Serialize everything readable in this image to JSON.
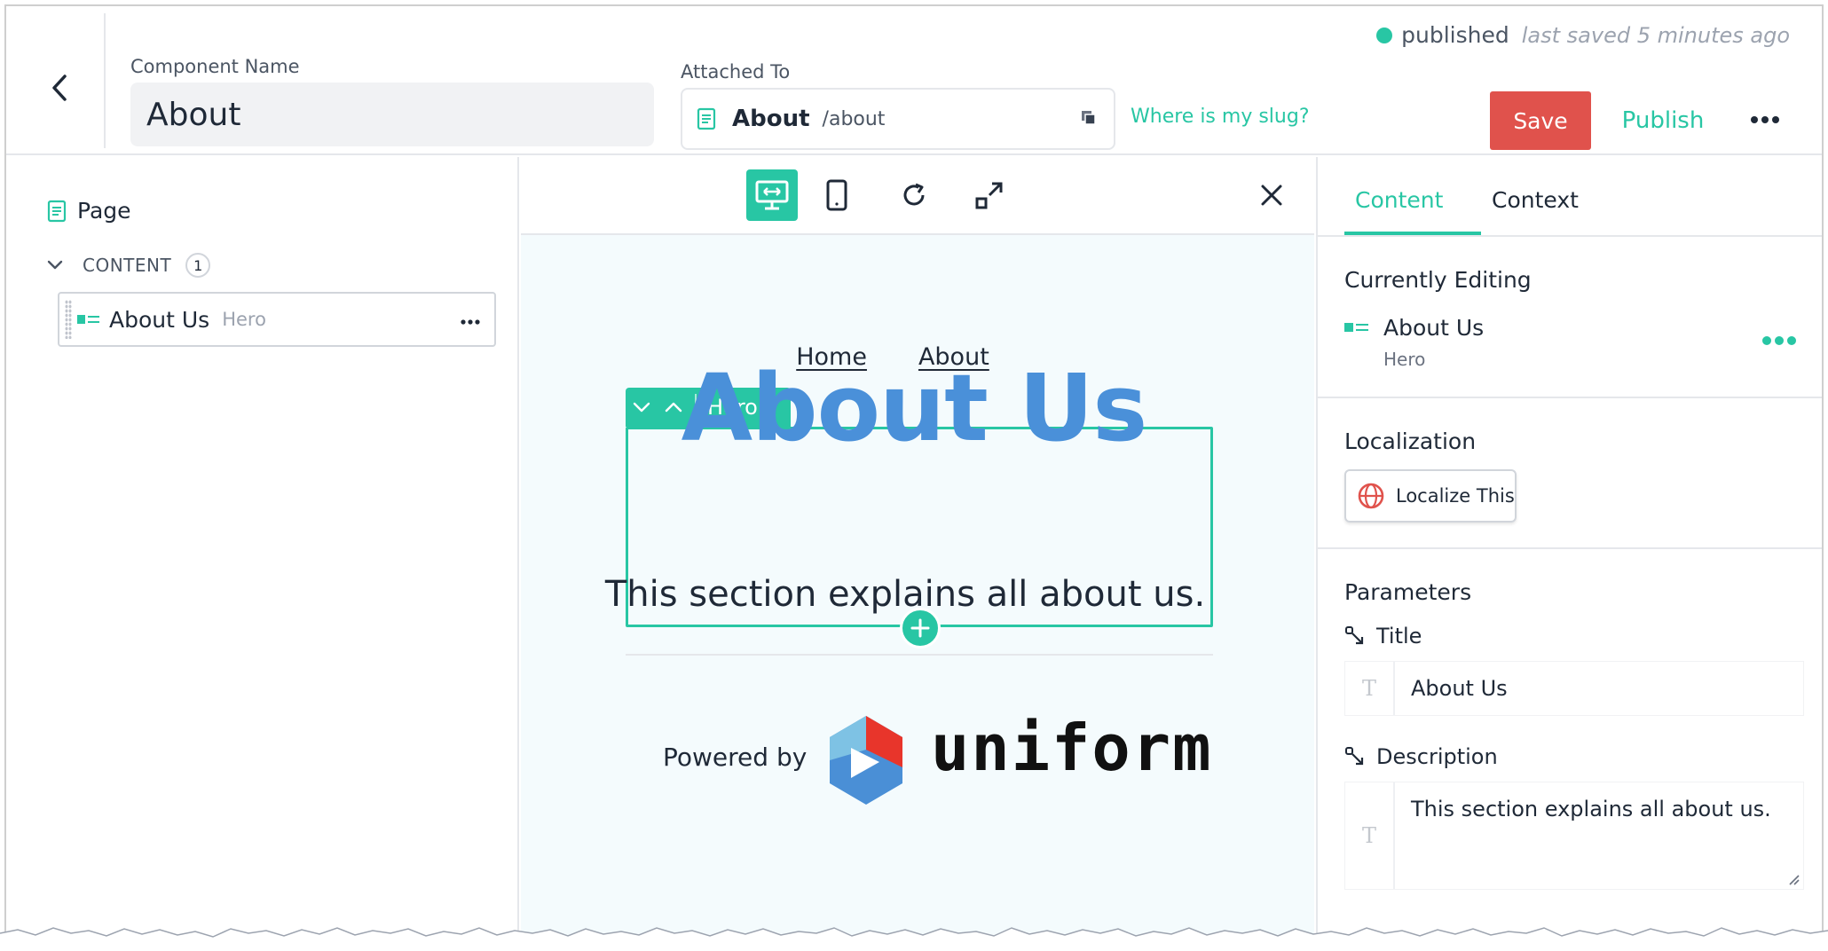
{
  "header": {
    "component_name_label": "Component Name",
    "component_name_value": "About",
    "attached_to_label": "Attached To",
    "attached_page_title": "About",
    "attached_slug": "/about",
    "slug_help_link": "Where is my slug?",
    "status": "published",
    "last_saved": "last saved 5 minutes ago",
    "save_label": "Save",
    "publish_label": "Publish"
  },
  "tree": {
    "root_label": "Page",
    "slot_label": "CONTENT",
    "slot_count": "1",
    "items": [
      {
        "name": "About Us",
        "type": "Hero"
      }
    ]
  },
  "preview": {
    "nav": [
      "Home",
      "About"
    ],
    "hero_tab_label": "Hero",
    "hero_title": "About Us",
    "hero_description": "This section explains all about us.",
    "powered_by": "Powered by",
    "brand_wordmark": "uniform"
  },
  "panel": {
    "tabs": [
      "Content",
      "Context"
    ],
    "active_tab": "Content",
    "currently_editing_title": "Currently Editing",
    "editing_name": "About Us",
    "editing_type": "Hero",
    "localization_title": "Localization",
    "localize_button": "Localize This",
    "parameters_title": "Parameters",
    "params": [
      {
        "label": "Title",
        "value": "About Us"
      },
      {
        "label": "Description",
        "value": "This section explains all about us."
      }
    ]
  },
  "colors": {
    "accent": "#28c6a4",
    "save": "#e0524c",
    "hero_title": "#4a90d9",
    "preview_bg": "#f4fbfd"
  },
  "icons": {
    "back": "chevron-left-icon",
    "page": "document-icon",
    "copy": "copy-icon",
    "more": "more-horizontal-icon",
    "desktop": "desktop-icon",
    "mobile": "mobile-icon",
    "refresh": "refresh-icon",
    "expand": "expand-icon",
    "close": "close-icon",
    "globe": "globe-icon",
    "connect": "connect-icon"
  }
}
